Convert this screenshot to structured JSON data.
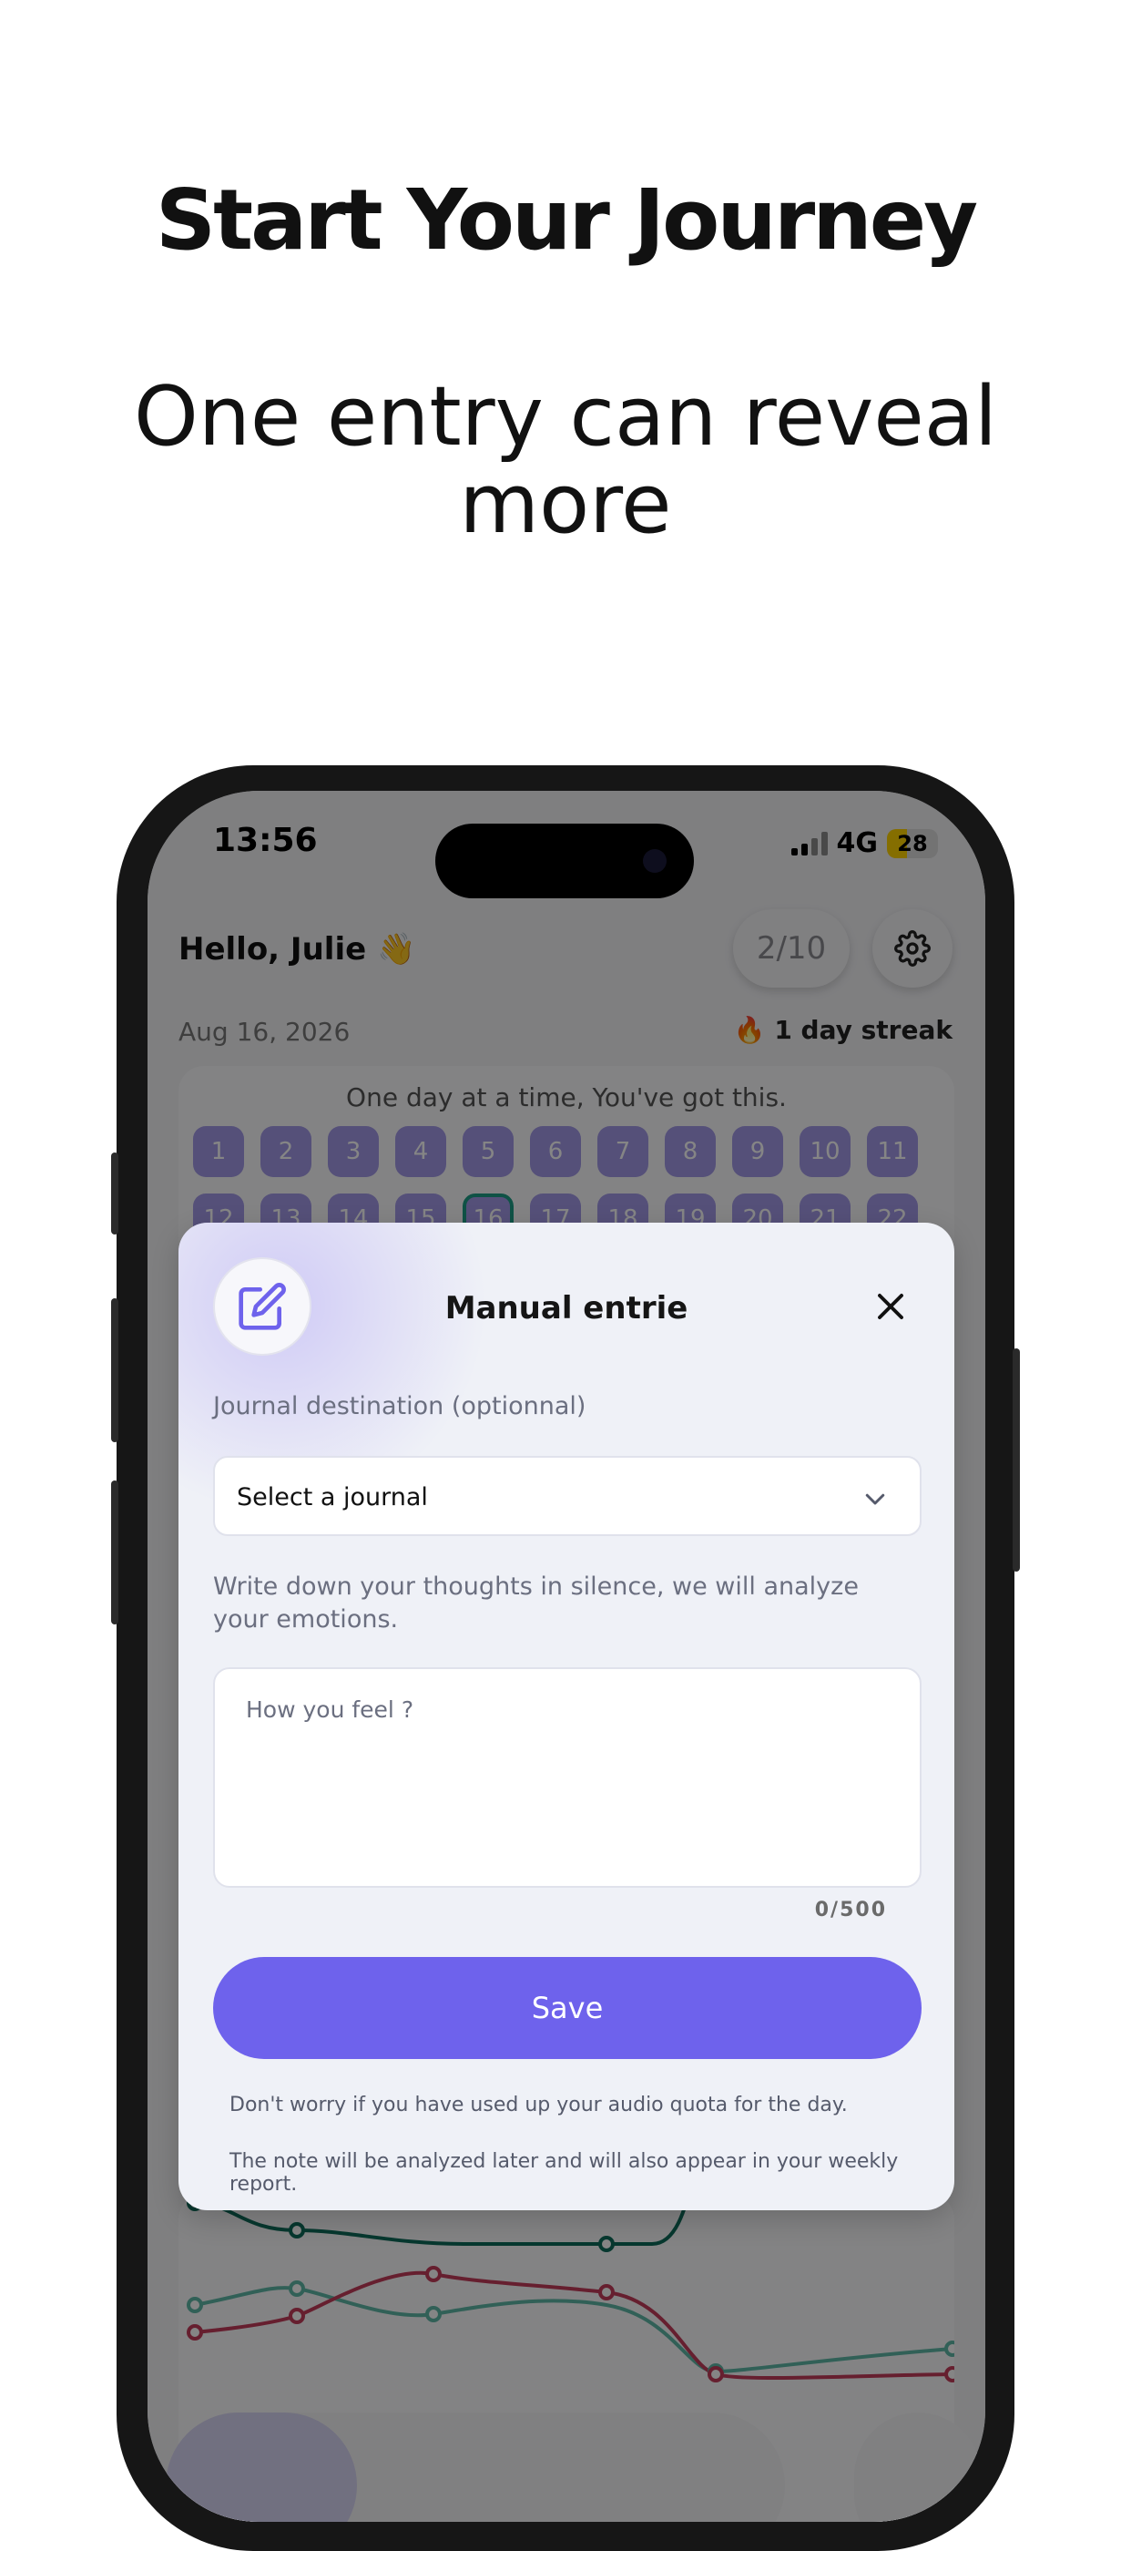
{
  "marketing": {
    "headline": "Start Your Journey",
    "subline": "One entry can reveal more"
  },
  "status_bar": {
    "time": "13:56",
    "network": "4G",
    "battery": "28"
  },
  "home": {
    "greeting": "Hello, Julie 👋",
    "quota": "2/10",
    "date": "Aug 16, 2026",
    "streak": "🔥 1 day streak",
    "calendar_title": "One day at a time, You've got this.",
    "days_row1": [
      "1",
      "2",
      "3",
      "4",
      "5",
      "6",
      "7",
      "8",
      "9",
      "10",
      "11"
    ],
    "days_row2": [
      "12",
      "13",
      "14",
      "15",
      "16",
      "17",
      "18",
      "19",
      "20",
      "21",
      "22"
    ],
    "today": "16"
  },
  "modal": {
    "title": "Manual entrie",
    "journal_label": "Journal destination (optionnal)",
    "journal_select": "Select a journal",
    "prompt_label": "Write down your thoughts in silence, we will analyze your emotions.",
    "textarea_placeholder": "How you feel ?",
    "counter": "0/500",
    "save": "Save",
    "note1": "Don't worry if you have used up your audio quota for the day.",
    "note2": "The note will be analyzed later and will also appear in your weekly report."
  },
  "colors": {
    "accent": "#6e62ec",
    "calendar_day": "#a39ae8",
    "today_ring": "#1e9d86",
    "series": [
      "#0f6b5a",
      "#5fb8a8",
      "#c43d5a"
    ]
  },
  "icons": [
    "edit-icon",
    "close-icon",
    "chevron-down-icon",
    "gear-icon",
    "signal-icon",
    "battery-icon"
  ]
}
